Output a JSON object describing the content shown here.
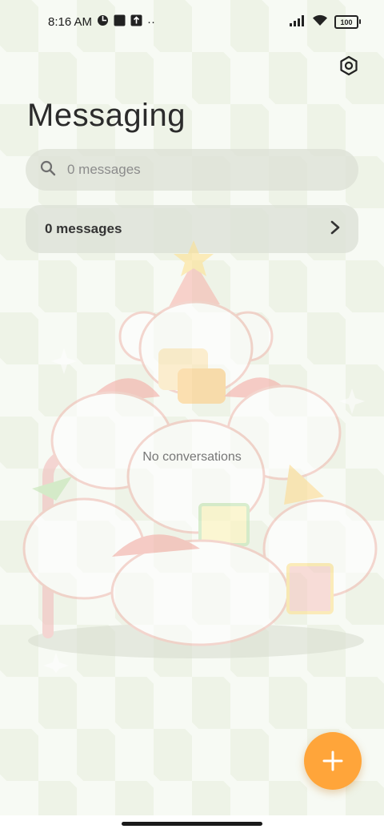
{
  "status_bar": {
    "time": "8:16 AM",
    "dots": "··",
    "battery": "100"
  },
  "header": {
    "title": "Messaging",
    "settings_icon": "settings-hexagon-icon"
  },
  "search": {
    "placeholder": "0 messages",
    "value": ""
  },
  "summary": {
    "label": "0 messages"
  },
  "empty_state": {
    "text": "No conversations"
  },
  "fab": {
    "icon": "plus-icon"
  },
  "colors": {
    "accent": "#ffa53a",
    "background": "#eef3e7",
    "card": "#dce0d6",
    "title": "#2b2b2b"
  }
}
